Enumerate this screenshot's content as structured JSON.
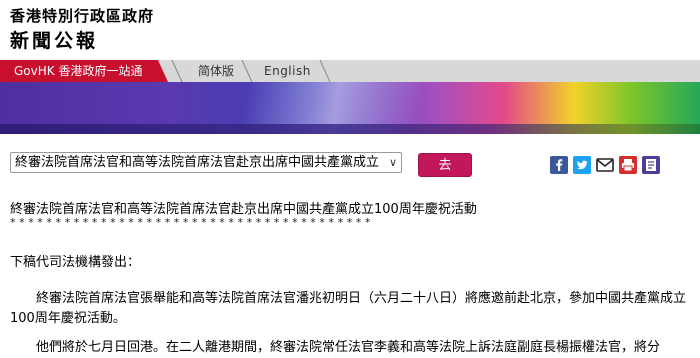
{
  "header": {
    "department": "香港特別行政區政府",
    "release_title": "新聞公報"
  },
  "nav": {
    "govhk_label": "GovHK 香港政府一站通",
    "simplified_label": "简体版",
    "english_label": "English"
  },
  "selector": {
    "selected_value": "終審法院首席法官和高等法院首席法官赴京出席中國共產黨成立100周年慶祝活動",
    "go_label": "去"
  },
  "share_icons": [
    "facebook-icon",
    "twitter-icon",
    "email-icon",
    "printer-icon",
    "bookmark-icon"
  ],
  "colors": {
    "govhk_red": "#c8102e",
    "go_button": "#c2185b",
    "facebook": "#3b5998",
    "twitter": "#1da1f2",
    "print_red": "#d32f2f",
    "bookmark": "#4a3f9a"
  },
  "article": {
    "title": "終審法院首席法官和高等法院首席法官赴京出席中國共產黨成立100周年慶祝活動",
    "separator": "****************************************",
    "intro": "下稿代司法機構發出：",
    "paragraph1": "終審法院首席法官張舉能和高等法院首席法官潘兆初明日（六月二十八日）將應邀前赴北京，參加中國共產黨成立100周年慶祝活動。",
    "paragraph2_partial": "他們將於七月日回港。在二人離港期間，終審法院常任法官李義和高等法院上訴法庭副庭長楊振權法官，將分"
  }
}
